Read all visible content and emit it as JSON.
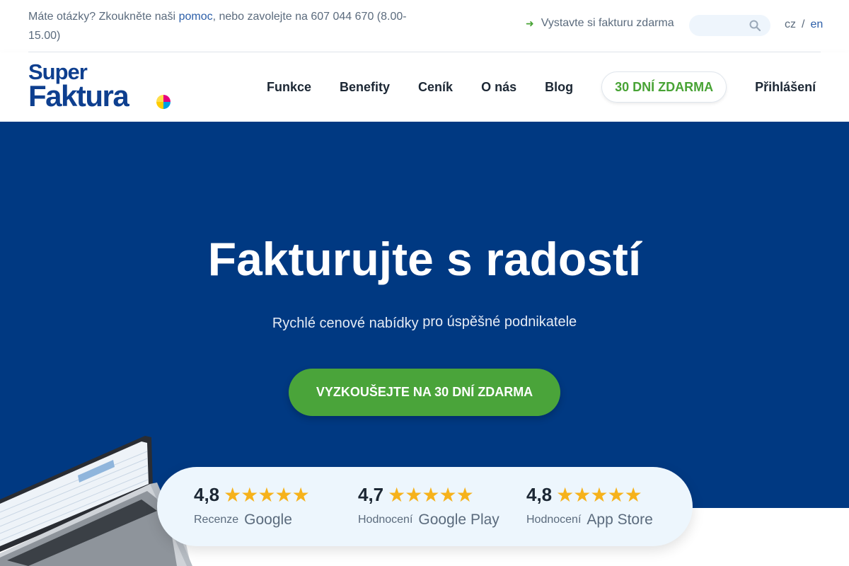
{
  "topbar": {
    "help_prefix": "Máte otázky? Zkoukněte naši ",
    "help_link": "pomoc",
    "help_suffix": ", nebo zavolejte na 607 044 670 (8.00-15.00)",
    "invoice_link": "Vystavte si fakturu zdarma",
    "search_icon": "search-icon",
    "lang_cz": "cz",
    "lang_sep": "/",
    "lang_en": "en"
  },
  "logo": {
    "line1": "Super",
    "line2": "Faktura"
  },
  "nav": {
    "items": [
      "Funkce",
      "Benefity",
      "Ceník",
      "O nás",
      "Blog"
    ],
    "trial_button": "30 DNÍ ZDARMA",
    "login": "Přihlášení"
  },
  "hero": {
    "title": "Fakturujte s radostí",
    "subtitle_a": "Rychlé cenové nabídky",
    "subtitle_b": "pro úspěšné podnikatele",
    "cta": "VYZKOUŠEJTE NA 30 DNÍ ZDARMA",
    "background_color": "#003982",
    "cta_color": "#4aa43a"
  },
  "ratings": [
    {
      "score": "4,8",
      "stars": 5,
      "label": "Recenze",
      "brand": "Google"
    },
    {
      "score": "4,7",
      "stars": 5,
      "label": "Hodnocení",
      "brand": "Google Play"
    },
    {
      "score": "4,8",
      "stars": 5,
      "label": "Hodnocení",
      "brand": "App Store"
    }
  ],
  "colors": {
    "brand_blue": "#0e3f8f",
    "accent_green": "#48a335",
    "star": "#f6b21b"
  }
}
